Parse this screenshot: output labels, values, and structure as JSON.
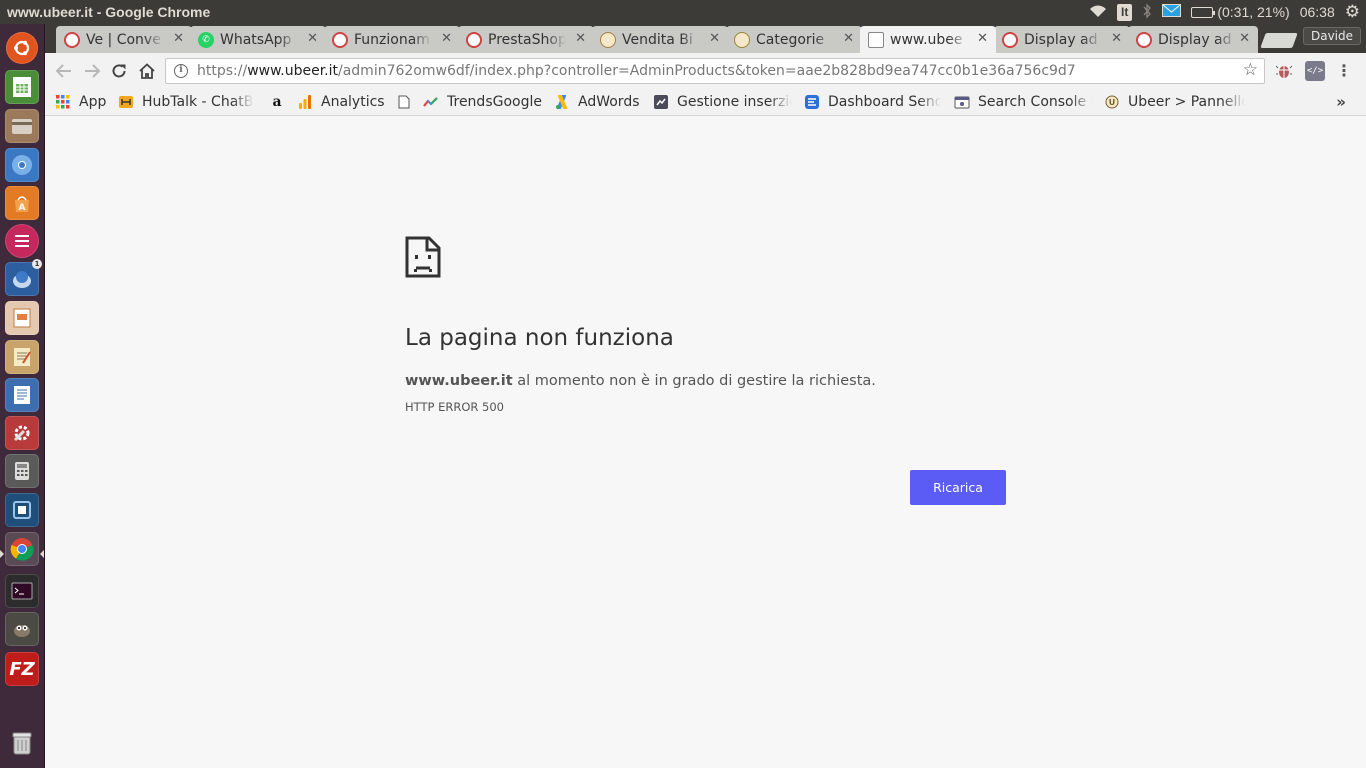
{
  "top_panel": {
    "window_title": "www.ubeer.it - Google Chrome",
    "keyboard_layout": "It",
    "battery": "(0:31, 21%)",
    "clock": "06:38",
    "icons": [
      "wifi-icon",
      "bluetooth-icon",
      "mail-icon",
      "battery-icon",
      "settings-gear-icon"
    ]
  },
  "launcher": {
    "items": [
      "ubuntu-dash",
      "libreoffice-calc",
      "file-manager",
      "chromium",
      "software-center",
      "elementary-app",
      "thunderbird",
      "libreoffice-impress",
      "text-editor",
      "libreoffice-writer",
      "system-settings",
      "calculator",
      "virtualbox",
      "google-chrome",
      "terminal",
      "gimp",
      "filezilla",
      "trash"
    ],
    "thunderbird_badge": "1"
  },
  "tabs": [
    {
      "title": "Ve | Conve",
      "favicon": "prestashop"
    },
    {
      "title": "WhatsApp",
      "favicon": "whatsapp"
    },
    {
      "title": "Funzionam",
      "favicon": "prestashop"
    },
    {
      "title": "PrestaShop",
      "favicon": "prestashop"
    },
    {
      "title": "Vendita Bi",
      "favicon": "ubeer"
    },
    {
      "title": "Categorie",
      "favicon": "ubeer"
    },
    {
      "title": "www.ubee",
      "favicon": "page",
      "active": true
    },
    {
      "title": "Display ad",
      "favicon": "prestashop"
    },
    {
      "title": "Display ad",
      "favicon": "prestashop"
    }
  ],
  "profile_name": "Davide",
  "omnibox": {
    "scheme": "https://",
    "host": "www.ubeer.it",
    "path": "/admin762omw6df/index.php?controller=AdminProducts&token=aae2b828bd9ea747cc0b1e36a756c9d7"
  },
  "bookmarks": [
    {
      "label": "App",
      "icon": "apps-grid"
    },
    {
      "label": "HubTalk - ChatBo",
      "icon": "hubtalk"
    },
    {
      "label": "",
      "icon": "amazon"
    },
    {
      "label": "Analytics",
      "icon": "analytics"
    },
    {
      "label": "",
      "icon": "blank-page"
    },
    {
      "label": "TrendsGoogle",
      "icon": "trends"
    },
    {
      "label": "AdWords",
      "icon": "adwords"
    },
    {
      "label": "Gestione inserzio",
      "icon": "gestione"
    },
    {
      "label": "Dashboard Send",
      "icon": "sendinblue"
    },
    {
      "label": "Search Console -",
      "icon": "search-console"
    },
    {
      "label": "Ubeer > Pannello",
      "icon": "ubeer"
    }
  ],
  "error_page": {
    "heading": "La pagina non funziona",
    "host": "www.ubeer.it",
    "message": " al momento non è in grado di gestire la richiesta.",
    "code": "HTTP ERROR 500",
    "reload_label": "Ricarica"
  },
  "colors": {
    "reload_button": "#5b5bf5",
    "launcher_bg": "#3e2a3a",
    "panel_bg": "#3c3b37"
  }
}
